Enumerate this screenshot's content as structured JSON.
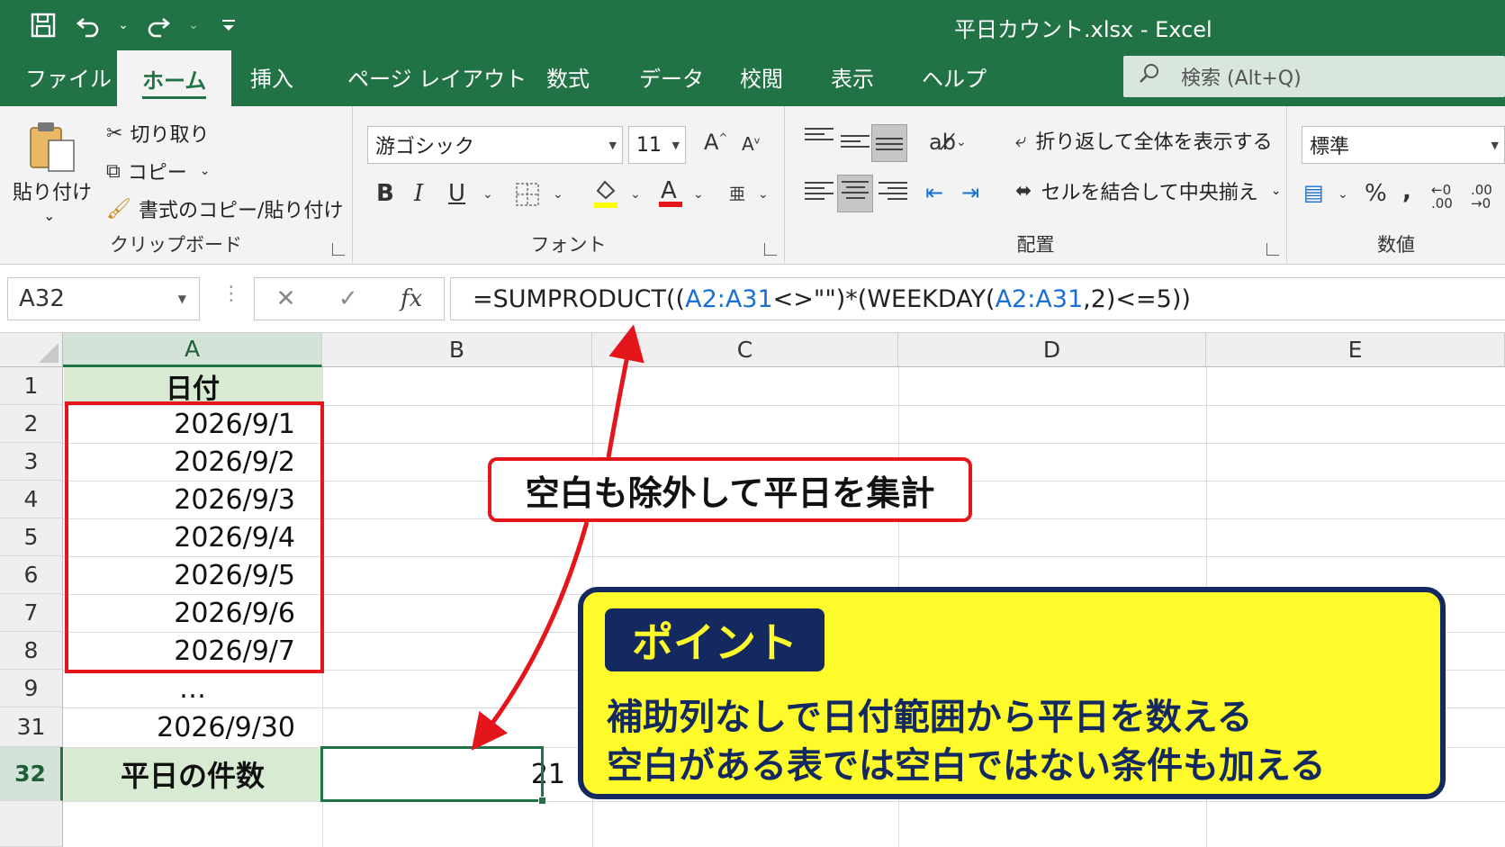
{
  "window": {
    "title": "平日カウント.xlsx  -  Excel"
  },
  "tabs": [
    {
      "label": "ファイル"
    },
    {
      "label": "ホーム"
    },
    {
      "label": "挿入"
    },
    {
      "label": "ページ レイアウト"
    },
    {
      "label": "数式"
    },
    {
      "label": "データ"
    },
    {
      "label": "校閲"
    },
    {
      "label": "表示"
    },
    {
      "label": "ヘルプ"
    }
  ],
  "search": {
    "placeholder": "検索 (Alt+Q)"
  },
  "ribbon": {
    "clipboard": {
      "paste": "貼り付け",
      "cut": "切り取り",
      "copy": "コピー",
      "format_painter": "書式のコピー/貼り付け",
      "label": "クリップボード"
    },
    "font": {
      "font_name": "游ゴシック",
      "font_size": "11",
      "label": "フォント"
    },
    "alignment": {
      "wrap": "折り返して全体を表示する",
      "merge": "セルを結合して中央揃え",
      "label": "配置"
    },
    "number": {
      "format": "標準",
      "label": "数値"
    }
  },
  "formula_bar": {
    "name_box": "A32",
    "fx": "fx",
    "formula_parts": [
      {
        "text": "=SUMPRODUCT((",
        "ref": false
      },
      {
        "text": "A2:A31",
        "ref": true
      },
      {
        "text": "<>\"\")*(WEEKDAY(",
        "ref": false
      },
      {
        "text": "A2:A31",
        "ref": true
      },
      {
        "text": ",2)<=5))",
        "ref": false
      }
    ]
  },
  "columns": [
    "A",
    "B",
    "C",
    "D",
    "E"
  ],
  "rows": [
    {
      "num": "1",
      "a": "日付",
      "b": ""
    },
    {
      "num": "2",
      "a": "2026/9/1",
      "b": ""
    },
    {
      "num": "3",
      "a": "2026/9/2",
      "b": ""
    },
    {
      "num": "4",
      "a": "2026/9/3",
      "b": ""
    },
    {
      "num": "5",
      "a": "2026/9/4",
      "b": ""
    },
    {
      "num": "6",
      "a": "2026/9/5",
      "b": ""
    },
    {
      "num": "7",
      "a": "2026/9/6",
      "b": ""
    },
    {
      "num": "8",
      "a": "2026/9/7",
      "b": ""
    },
    {
      "num": "9",
      "a": "…",
      "b": ""
    },
    {
      "num": "31",
      "a": "2026/9/30",
      "b": ""
    },
    {
      "num": "32",
      "a": "平日の件数",
      "b": "21"
    }
  ],
  "callout": "空白も除外して平日を集計",
  "point": {
    "tag": "ポイント",
    "line1": "補助列なしで日付範囲から平日を数える",
    "line2": "空白がある表では空白ではない条件も加える"
  },
  "colors": {
    "excel_green": "#217346",
    "accent_red": "#e5161b",
    "point_yellow": "#fffb2a",
    "point_navy": "#13295f",
    "ref_blue": "#1a6fd3"
  }
}
